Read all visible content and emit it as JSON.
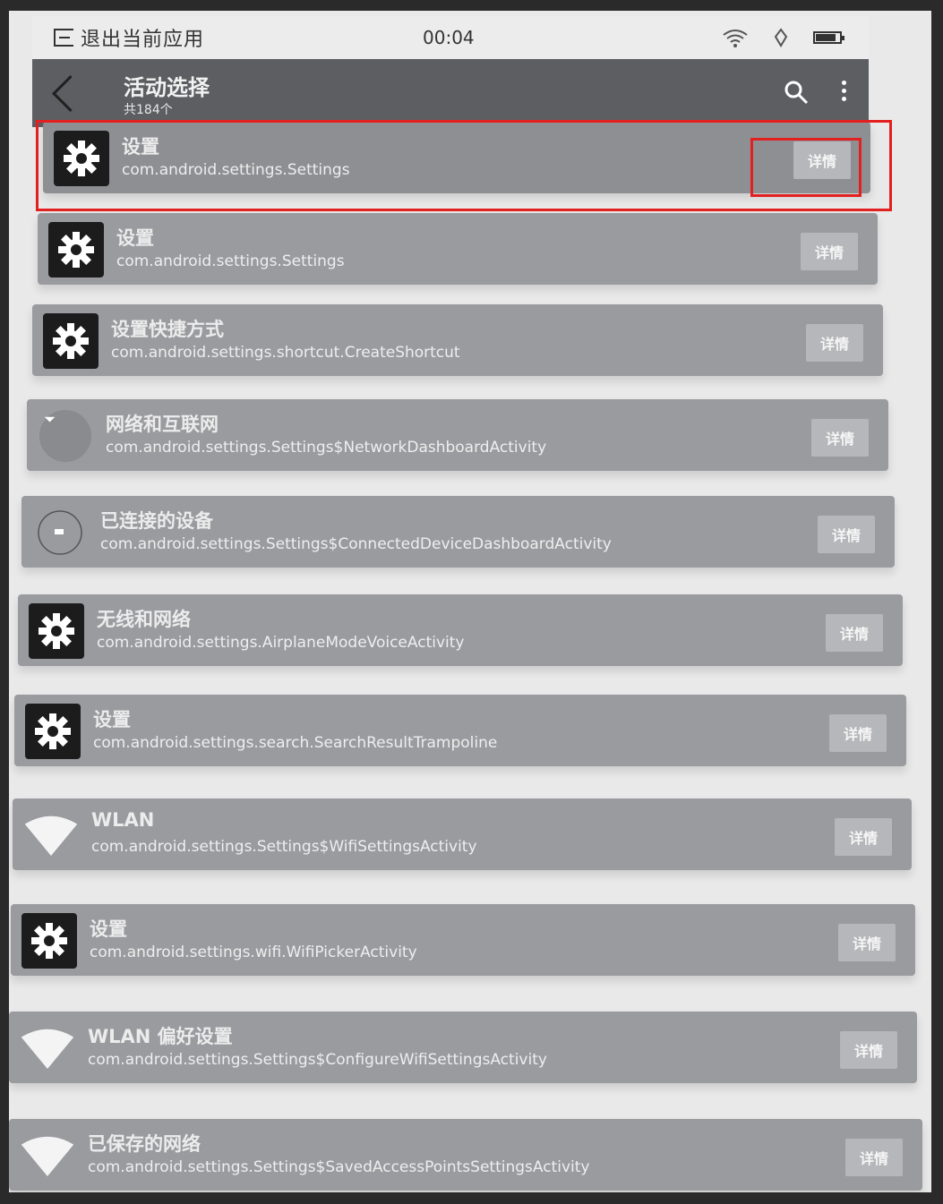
{
  "status_bar": {
    "exit_label": "退出当前应用",
    "time": "00:04"
  },
  "app_bar": {
    "title": "活动选择",
    "subtitle": "共184个"
  },
  "items": [
    {
      "title": "设置",
      "activity": "com.android.settings.Settings",
      "icon": "gear-icon",
      "button": "详情"
    },
    {
      "title": "设置",
      "activity": "com.android.settings.Settings",
      "icon": "gear-icon",
      "button": "详情"
    },
    {
      "title": "设置快捷方式",
      "activity": "com.android.settings.shortcut.CreateShortcut",
      "icon": "gear-icon",
      "button": "详情"
    },
    {
      "title": "网络和互联网",
      "activity": "com.android.settings.Settings$NetworkDashboardActivity",
      "icon": "network-icon",
      "button": "详情"
    },
    {
      "title": "已连接的设备",
      "activity": "com.android.settings.Settings$ConnectedDeviceDashboardActivity",
      "icon": "device-icon",
      "button": "详情"
    },
    {
      "title": "无线和网络",
      "activity": "com.android.settings.AirplaneModeVoiceActivity",
      "icon": "gear-icon",
      "button": "详情"
    },
    {
      "title": "设置",
      "activity": "com.android.settings.search.SearchResultTrampoline",
      "icon": "gear-icon",
      "button": "详情"
    },
    {
      "title": "WLAN",
      "activity": "com.android.settings.Settings$WifiSettingsActivity",
      "icon": "wifi-icon",
      "button": "详情"
    },
    {
      "title": "设置",
      "activity": "com.android.settings.wifi.WifiPickerActivity",
      "icon": "gear-icon",
      "button": "详情"
    },
    {
      "title": "WLAN 偏好设置",
      "activity": "com.android.settings.Settings$ConfigureWifiSettingsActivity",
      "icon": "wifi-icon",
      "button": "详情"
    },
    {
      "title": "已保存的网络",
      "activity": "com.android.settings.Settings$SavedAccessPointsSettingsActivity",
      "icon": "wifi-icon",
      "button": "详情"
    }
  ],
  "annotation_color": "#e32020"
}
